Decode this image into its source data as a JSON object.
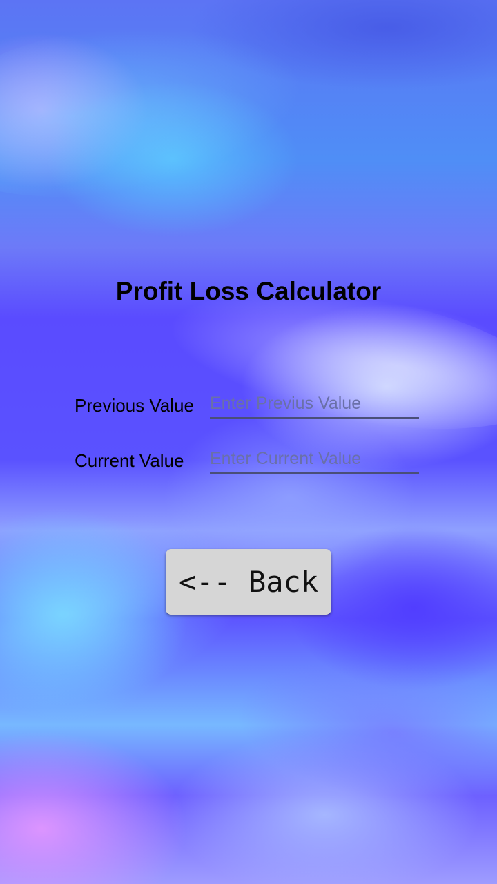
{
  "screen": {
    "title": "Profit Loss Calculator"
  },
  "form": {
    "previous": {
      "label": "Previous Value",
      "value": "",
      "placeholder": "Enter Previus Value"
    },
    "current": {
      "label": "Current Value",
      "value": "",
      "placeholder": "Enter Current Value"
    }
  },
  "actions": {
    "back_label": "<-- Back"
  },
  "colors": {
    "background_primary": "#5a4cff",
    "button_bg": "#d6d6d6",
    "title_text": "#000000",
    "placeholder_text": "#6a70a8"
  }
}
